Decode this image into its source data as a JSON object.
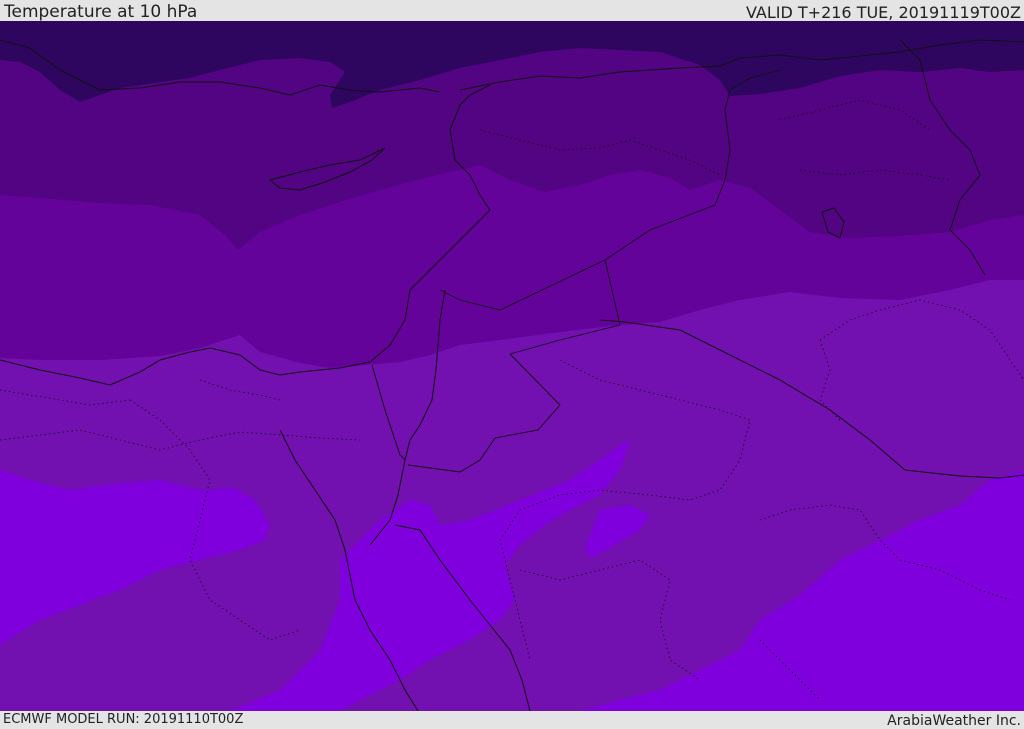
{
  "header": {
    "title": "Temperature at 10 hPa",
    "valid_time": "VALID T+216 TUE, 20191119T00Z"
  },
  "footer": {
    "model_run": "ECMWF MODEL RUN: 20191110T00Z",
    "credit": "ArabiaWeather Inc."
  },
  "map": {
    "field": "Temperature at 10 hPa",
    "band_colors": [
      "#2e0660",
      "#520482",
      "#64039a",
      "#7210b0",
      "#7f00dd"
    ]
  }
}
